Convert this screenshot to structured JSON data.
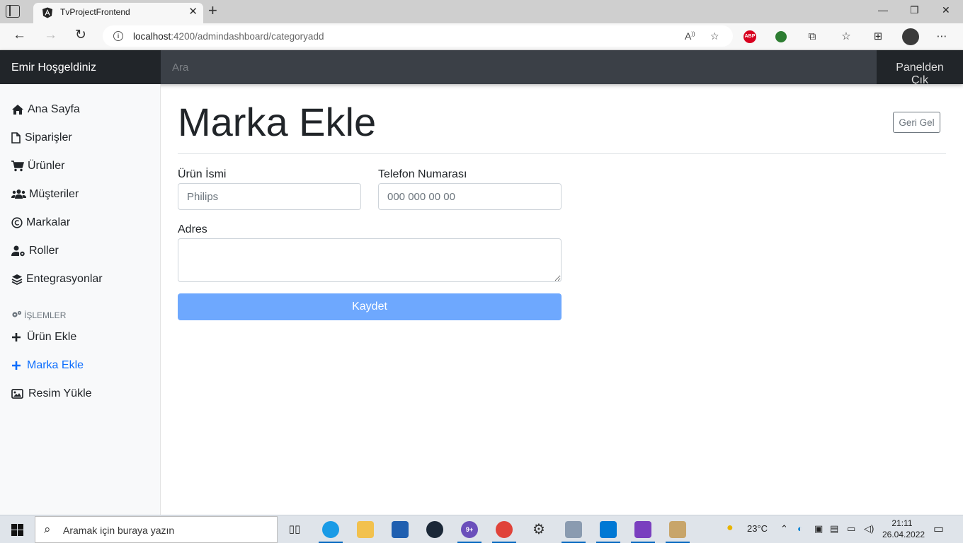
{
  "browser": {
    "tab_title": "TvProjectFrontend",
    "tab_close": "✕",
    "new_tab": "+",
    "url_host": "localhost",
    "url_path": ":4200/admindashboard/categoryadd",
    "window_controls": [
      "—",
      "❐",
      "✕"
    ]
  },
  "header": {
    "brand": "Emir Hoşgeldiniz",
    "search_placeholder": "Ara",
    "signout": "Panelden Çık"
  },
  "sidebar": {
    "items": [
      {
        "label": "Ana Sayfa",
        "icon": "home-icon"
      },
      {
        "label": "Siparişler",
        "icon": "file-icon"
      },
      {
        "label": "Ürünler",
        "icon": "cart-icon"
      },
      {
        "label": "Müşteriler",
        "icon": "users-icon"
      },
      {
        "label": "Markalar",
        "icon": "copyright-icon"
      },
      {
        "label": "Roller",
        "icon": "user-gear-icon"
      },
      {
        "label": "Entegrasyonlar",
        "icon": "layers-icon"
      }
    ],
    "section_heading": "İŞLEMLER",
    "actions": [
      {
        "label": "Ürün Ekle",
        "icon": "plus-icon"
      },
      {
        "label": "Marka Ekle",
        "icon": "plus-icon",
        "active": true
      },
      {
        "label": "Resim Yükle",
        "icon": "image-icon"
      }
    ]
  },
  "main": {
    "title": "Marka Ekle",
    "back_button": "Geri Gel",
    "form": {
      "name_label": "Ürün İsmi",
      "name_placeholder": "Philips",
      "phone_label": "Telefon Numarası",
      "phone_placeholder": "000 000 00 00",
      "address_label": "Adres",
      "address_value": "",
      "save_button": "Kaydet"
    }
  },
  "taskbar": {
    "search_placeholder": "Aramak için buraya yazın",
    "weather_temp": "23°C",
    "time": "21:11",
    "date": "26.04.2022",
    "badge": "9+"
  },
  "colors": {
    "accent": "#0d6efd",
    "save_button": "#6ea8fe",
    "header_bg": "#343a40",
    "brand_bg": "#212529"
  }
}
